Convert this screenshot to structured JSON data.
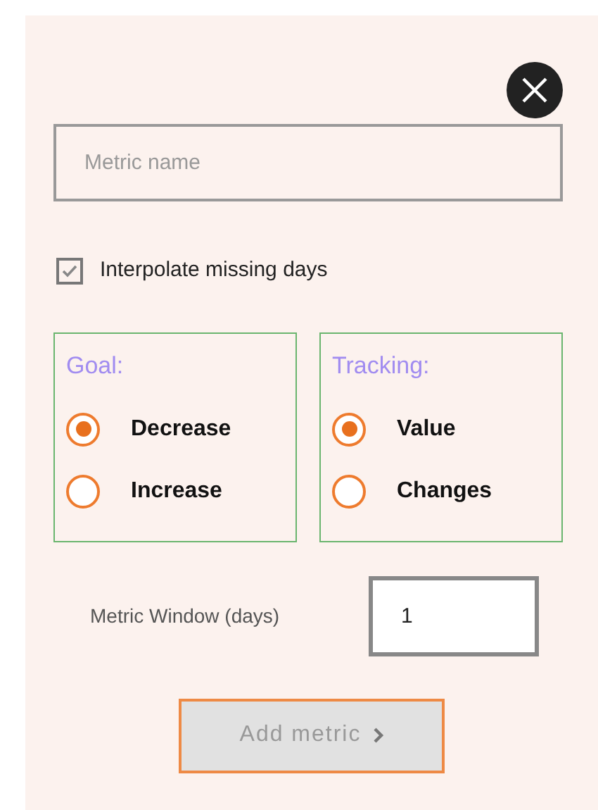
{
  "name_field": {
    "placeholder": "Metric name"
  },
  "interpolate": {
    "label": "Interpolate missing days",
    "checked": true
  },
  "groups": [
    {
      "title": "Goal:",
      "options": [
        {
          "label": "Decrease",
          "selected": true
        },
        {
          "label": "Increase",
          "selected": false
        }
      ]
    },
    {
      "title": "Tracking:",
      "options": [
        {
          "label": "Value",
          "selected": true
        },
        {
          "label": "Changes",
          "selected": false
        }
      ]
    }
  ],
  "window_field": {
    "label": "Metric Window (days)",
    "value": "1"
  },
  "submit": {
    "label": "Add metric",
    "disabled": true
  }
}
